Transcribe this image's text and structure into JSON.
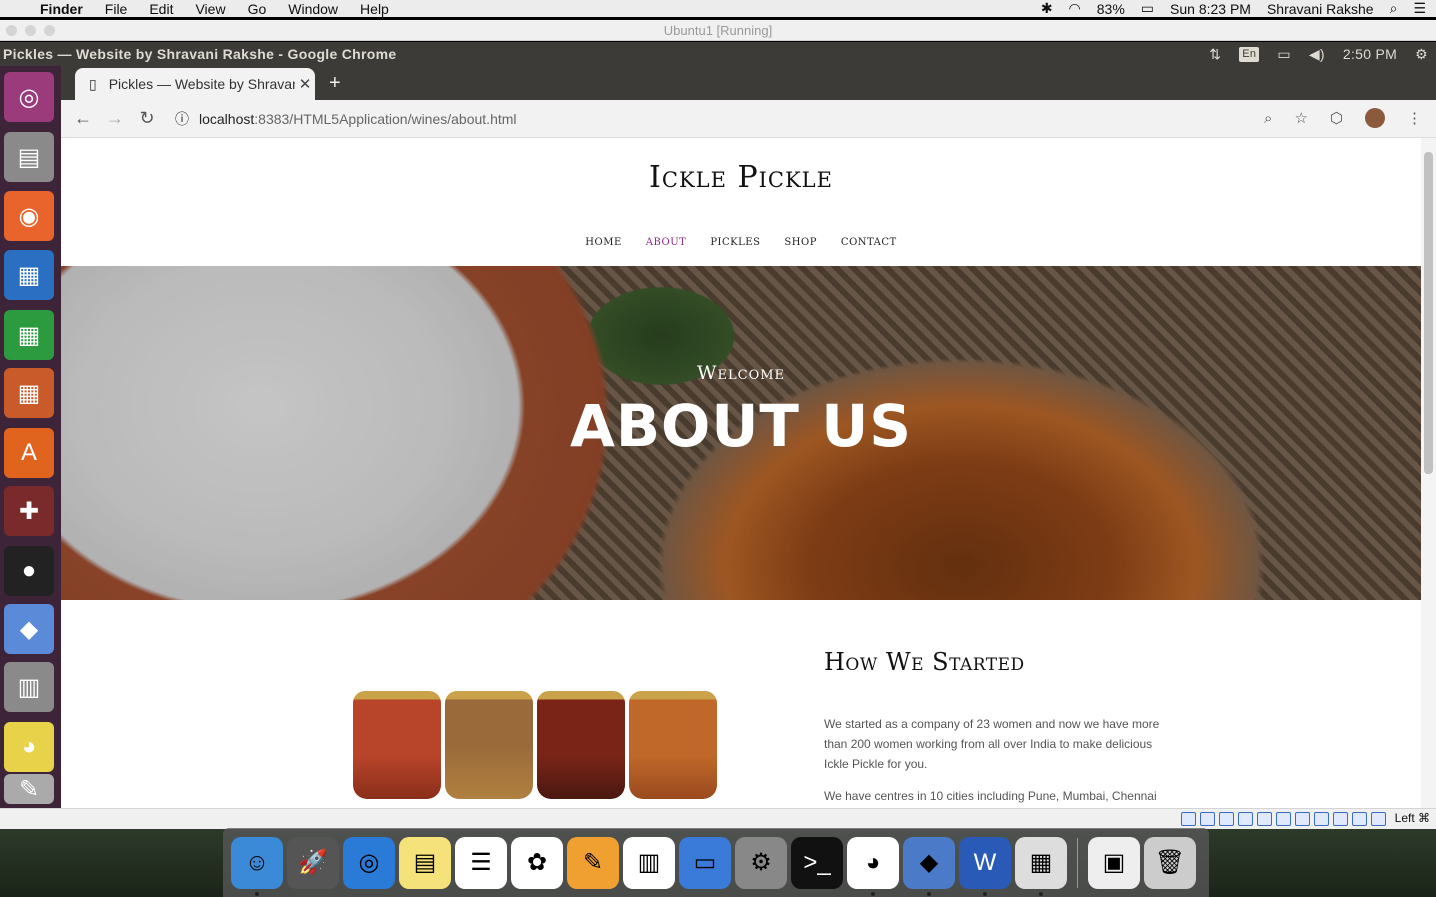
{
  "mac_menu": {
    "app": "Finder",
    "items": [
      "File",
      "Edit",
      "View",
      "Go",
      "Window",
      "Help"
    ],
    "battery": "83%",
    "datetime": "Sun 8:23 PM",
    "user": "Shravani Rakshe"
  },
  "vbox": {
    "title": "Ubuntu1 [Running]"
  },
  "ubuntu_panel": {
    "window_title": "Pickles — Website by Shravani Rakshe - Google Chrome",
    "lang": "En",
    "time": "2:50 PM"
  },
  "browser": {
    "tab_title": "Pickles — Website by Shravani Rakshe",
    "url_host": "localhost",
    "url_path": ":8383/HTML5Application/wines/about.html"
  },
  "site": {
    "title": "Ickle Pickle",
    "nav": [
      "HOME",
      "ABOUT",
      "PICKLES",
      "SHOP",
      "CONTACT"
    ],
    "hero_sub": "Welcome",
    "hero_title": "ABOUT US",
    "section_title": "How We Started",
    "para1": "We started as a company of 23 women and now we have more than 200 women working from all over India to make delicious Ickle Pickle for you.",
    "para2": "We have centres in 10 cities including Pune, Mumbai, Chennai"
  },
  "statusbar": {
    "host_key": "Left ⌘"
  },
  "colors": {
    "nav_active": "#8a2b8a",
    "launcher_bg": "#3e2438",
    "panel_bg": "#3c3b37"
  }
}
